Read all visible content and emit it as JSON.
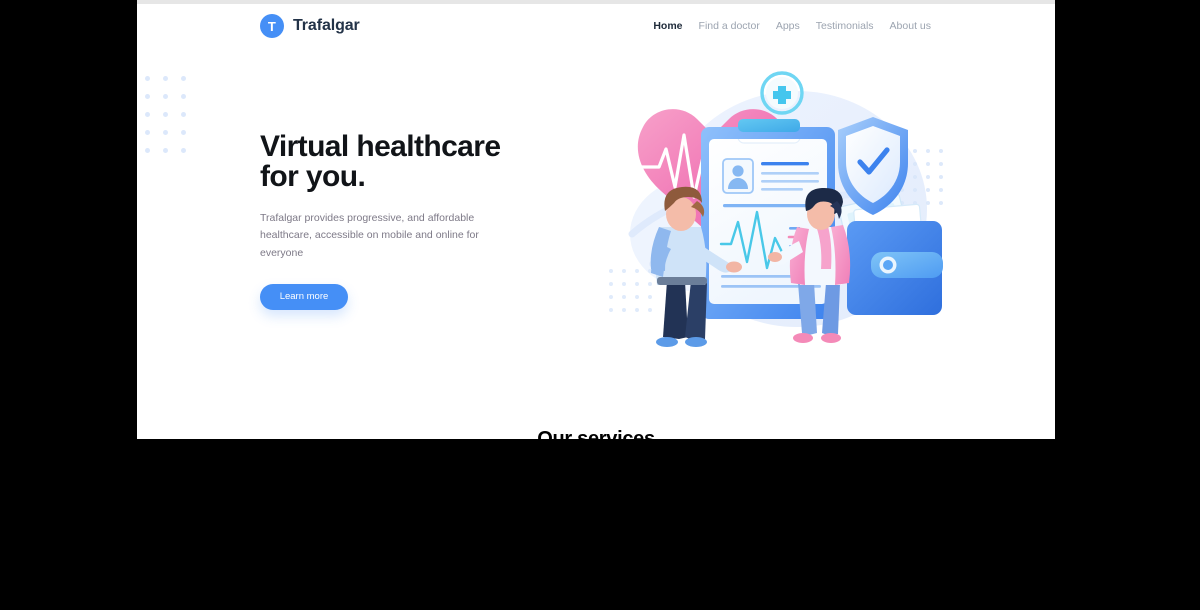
{
  "browser": {
    "viewport_background": "#ffffff",
    "letterbox_color": "#000000"
  },
  "header": {
    "brand": {
      "mark_letter": "T",
      "name": "Trafalgar",
      "mark_color": "#458FF6",
      "name_color": "#233348"
    },
    "nav": [
      {
        "label": "Home",
        "active": true
      },
      {
        "label": "Find a doctor",
        "active": false
      },
      {
        "label": "Apps",
        "active": false
      },
      {
        "label": "Testimonials",
        "active": false
      },
      {
        "label": "About us",
        "active": false
      }
    ]
  },
  "hero": {
    "title": "Virtual healthcare\nfor you.",
    "subtitle": "Trafalgar provides progressive, and affordable healthcare, accessible on mobile and online for everyone",
    "cta_label": "Learn more",
    "cta_color": "#458FF6",
    "illustration": {
      "name": "virtual-healthcare-illustration",
      "elements": [
        "heart-with-ecg-icon",
        "medical-clipboard",
        "patient-avatar",
        "shield-check-icon",
        "wallet-with-cash",
        "medical-cross-badge",
        "person-patient",
        "person-doctor",
        "dot-grid-pattern"
      ],
      "colors": {
        "heart_pink": "#F178B6",
        "clipboard_blue": "#458FF6",
        "accent_cyan": "#3ED0F5",
        "wallet_blue": "#3C7FE8",
        "coat_pink": "#F598C8"
      }
    }
  },
  "next_section": {
    "heading": "Our services"
  }
}
